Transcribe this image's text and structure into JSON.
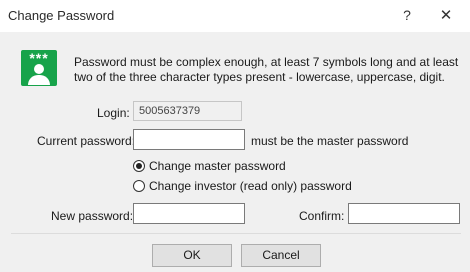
{
  "window": {
    "title": "Change Password",
    "help_glyph": "?",
    "close_glyph": "✕"
  },
  "icon": {
    "name": "password-key-icon",
    "stars": "***",
    "color": "#17a34a"
  },
  "info_text": "Password must be complex enough, at least 7 symbols long and at least two of the three character types present - lowercase, uppercase, digit.",
  "form": {
    "login_label": "Login:",
    "login_value": "5005637379",
    "current_label": "Current password:",
    "current_value": "",
    "current_hint": "must be the master password",
    "radio_master": "Change master password",
    "radio_investor": "Change investor (read only) password",
    "radio_selected": "master",
    "new_label": "New password:",
    "new_value": "",
    "confirm_label": "Confirm:",
    "confirm_value": ""
  },
  "buttons": {
    "ok": "OK",
    "cancel": "Cancel"
  }
}
